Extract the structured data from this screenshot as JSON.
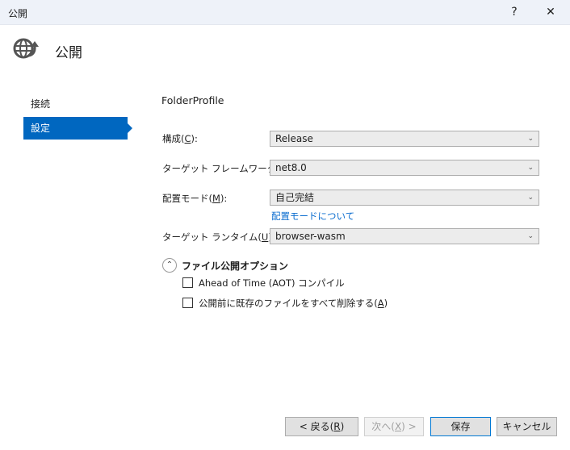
{
  "window": {
    "title": "公開",
    "help": "?",
    "close": "✕"
  },
  "header": {
    "title": "公開",
    "icon": "globe-publish-icon"
  },
  "sidebar": {
    "items": [
      {
        "label": "接続",
        "selected": false
      },
      {
        "label": "設定",
        "selected": true
      }
    ]
  },
  "profile": {
    "name": "FolderProfile"
  },
  "fields": [
    {
      "pre": "構成(",
      "key": "C",
      "post": "):",
      "value": "Release"
    },
    {
      "pre": "ターゲット フレームワーク(",
      "key": "F",
      "post": "):",
      "value": "net8.0"
    },
    {
      "pre": "配置モード(",
      "key": "M",
      "post": "):",
      "value": "自己完結"
    },
    {
      "pre": "ターゲット ランタイム(",
      "key": "U",
      "post": "):",
      "value": "browser-wasm"
    }
  ],
  "deploy_mode_link": "配置モードについて",
  "options": {
    "title": "ファイル公開オプション",
    "expanded": true,
    "aot": {
      "label": "Ahead of Time (AOT) コンパイル",
      "checked": false
    },
    "delete": {
      "pre": "公開前に既存のファイルをすべて削除する(",
      "key": "A",
      "post": ")",
      "checked": false
    }
  },
  "buttons": {
    "back": {
      "pre": "< 戻る(",
      "key": "R",
      "post": ")"
    },
    "next": {
      "pre": "次へ(",
      "key": "X",
      "post": ") >"
    },
    "save": "保存",
    "cancel": "キャンセル"
  }
}
